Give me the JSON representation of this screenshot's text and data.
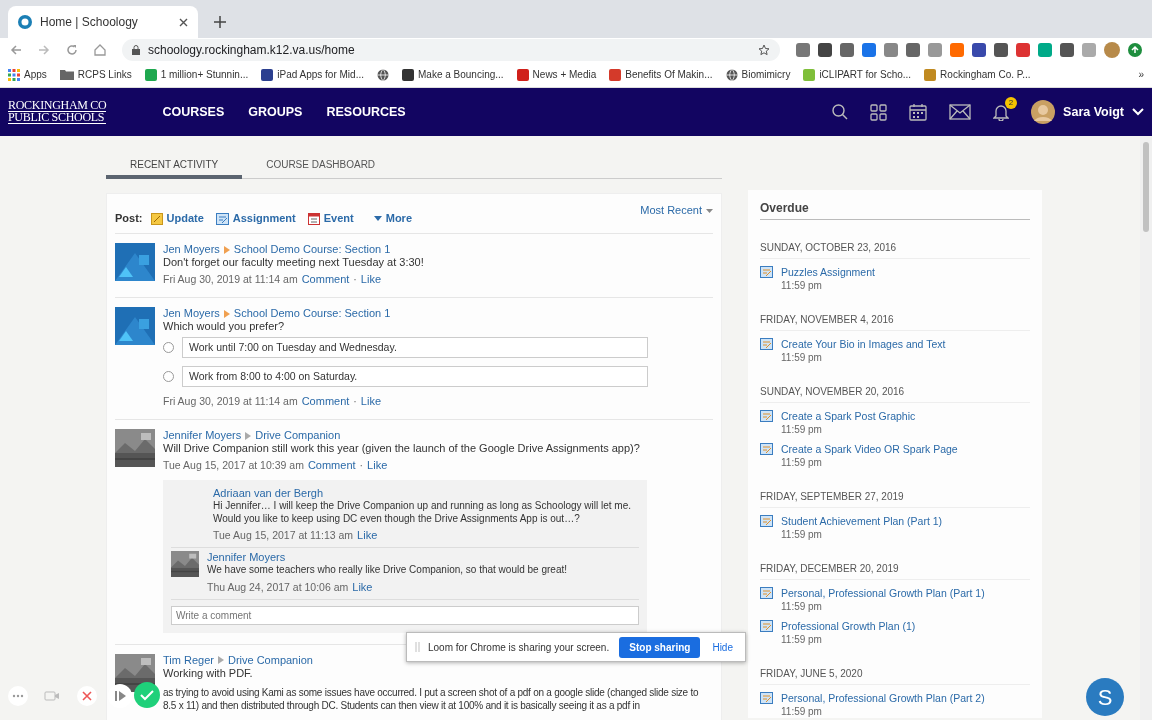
{
  "browser": {
    "tab_title": "Home | Schoology",
    "url": "schoology.rockingham.k12.va.us/home",
    "bookmarks": [
      {
        "label": "Apps",
        "kind": "apps"
      },
      {
        "label": "RCPS Links",
        "kind": "folder"
      },
      {
        "label": "1 million+ Stunnin...",
        "kind": "tile",
        "color": "#1fa84f"
      },
      {
        "label": "iPad Apps for Mid...",
        "kind": "tile",
        "color": "#2b3f8f"
      },
      {
        "kind": "globe"
      },
      {
        "label": "Make a Bouncing...",
        "kind": "tile",
        "color": "#333333"
      },
      {
        "label": "News + Media",
        "kind": "tile",
        "color": "#d0201a"
      },
      {
        "label": "Benefits Of Makin...",
        "kind": "tile",
        "color": "#d43a2a"
      },
      {
        "label": "Biomimicry",
        "kind": "globe"
      },
      {
        "label": "iCLIPART for Scho...",
        "kind": "tile",
        "color": "#7fbf3a"
      },
      {
        "label": "Rockingham Co. P...",
        "kind": "tile",
        "color": "#c08a20"
      }
    ],
    "more_bookmarks": "»"
  },
  "navbar": {
    "logo": [
      "ROCKINGHAM CO",
      "PUBLIC SCHOOLS"
    ],
    "menu": [
      "COURSES",
      "GROUPS",
      "RESOURCES"
    ],
    "notifications_count": "2",
    "user": "Sara Voigt"
  },
  "tabs": [
    {
      "label": "RECENT ACTIVITY",
      "selected": true
    },
    {
      "label": "COURSE DASHBOARD",
      "selected": false
    }
  ],
  "post_bar": {
    "label": "Post:",
    "actions": [
      {
        "label": "Update",
        "kind": "update"
      },
      {
        "label": "Assignment",
        "kind": "assignment"
      },
      {
        "label": "Event",
        "kind": "event"
      },
      {
        "label": "More",
        "kind": "more"
      }
    ],
    "sort": "Most Recent"
  },
  "link_separator": "·",
  "feed": [
    {
      "author": "Jen Moyers",
      "course": "School Demo Course: Section 1",
      "text": "Don't forget our faculty meeting next Tuesday at 3:30!",
      "time": "Fri Aug 30, 2019 at 11:14 am",
      "actions": [
        "Comment",
        "Like"
      ]
    },
    {
      "author": "Jen Moyers",
      "course": "School Demo Course: Section 1",
      "text": "Which would you prefer?",
      "options": [
        {
          "label": "Work until 7:00 on Tuesday and Wednesday.",
          "selected": false
        },
        {
          "label": "Work from 8:00 to 4:00 on Saturday.",
          "selected": false
        }
      ],
      "time": "Fri Aug 30, 2019 at 11:14 am",
      "actions": [
        "Comment",
        "Like"
      ]
    },
    {
      "author": "Jennifer Moyers",
      "course": "Drive Companion",
      "text": "Will Drive Companion still work this year (given the launch of the Google Drive Assignments app)?",
      "time": "Tue Aug 15, 2017 at 10:39 am",
      "actions": [
        "Comment",
        "Like"
      ],
      "comments": [
        {
          "author": "Adriaan van der Bergh",
          "text": "Hi Jennifer… I will keep the Drive Companion up and running as long as Schoology will let me. Would you like to keep using DC even though the Drive Assignments App is out…?",
          "time": "Tue Aug 15, 2017 at 11:13 am",
          "action": "Like"
        },
        {
          "author": "Jennifer Moyers",
          "text": "We have some teachers who really like Drive Companion, so that would be great!",
          "time": "Thu Aug 24, 2017 at 10:06 am",
          "action": "Like"
        }
      ],
      "comment_placeholder": "Write a comment"
    },
    {
      "author": "Tim Reger",
      "course": "Drive Companion",
      "text": "Working with PDF.",
      "body": "as trying to avoid using Kami as some issues have occurred. I put a screen shot of a pdf on a google slide (changed slide size to 8.5 x 11) and then distributed through DC. Students can then view it at 100% and it is basically seeing it as a pdf in"
    }
  ],
  "overdue": {
    "title": "Overdue",
    "groups": [
      {
        "date": "SUNDAY, OCTOBER 23, 2016",
        "items": [
          {
            "title": "Puzzles Assignment",
            "time": "11:59 pm"
          }
        ]
      },
      {
        "date": "FRIDAY, NOVEMBER 4, 2016",
        "items": [
          {
            "title": "Create Your Bio in Images and Text",
            "time": "11:59 pm"
          }
        ]
      },
      {
        "date": "SUNDAY, NOVEMBER 20, 2016",
        "items": [
          {
            "title": "Create a Spark Post Graphic",
            "time": "11:59 pm"
          },
          {
            "title": "Create a Spark Video OR Spark Page",
            "time": "11:59 pm"
          }
        ]
      },
      {
        "date": "FRIDAY, SEPTEMBER 27, 2019",
        "items": [
          {
            "title": "Student Achievement Plan (Part 1)",
            "time": "11:59 pm"
          }
        ]
      },
      {
        "date": "FRIDAY, DECEMBER 20, 2019",
        "items": [
          {
            "title": "Personal, Professional Growth Plan (Part 1)",
            "time": "11:59 pm"
          },
          {
            "title": "Professional Growth Plan (1)",
            "time": "11:59 pm"
          }
        ]
      },
      {
        "date": "FRIDAY, JUNE 5, 2020",
        "items": [
          {
            "title": "Personal, Professional Growth Plan (Part 2)",
            "time": "11:59 pm"
          }
        ]
      }
    ]
  },
  "loom": {
    "message": "Loom for Chrome is sharing your screen.",
    "stop": "Stop sharing",
    "hide": "Hide"
  },
  "chat_button": "S"
}
